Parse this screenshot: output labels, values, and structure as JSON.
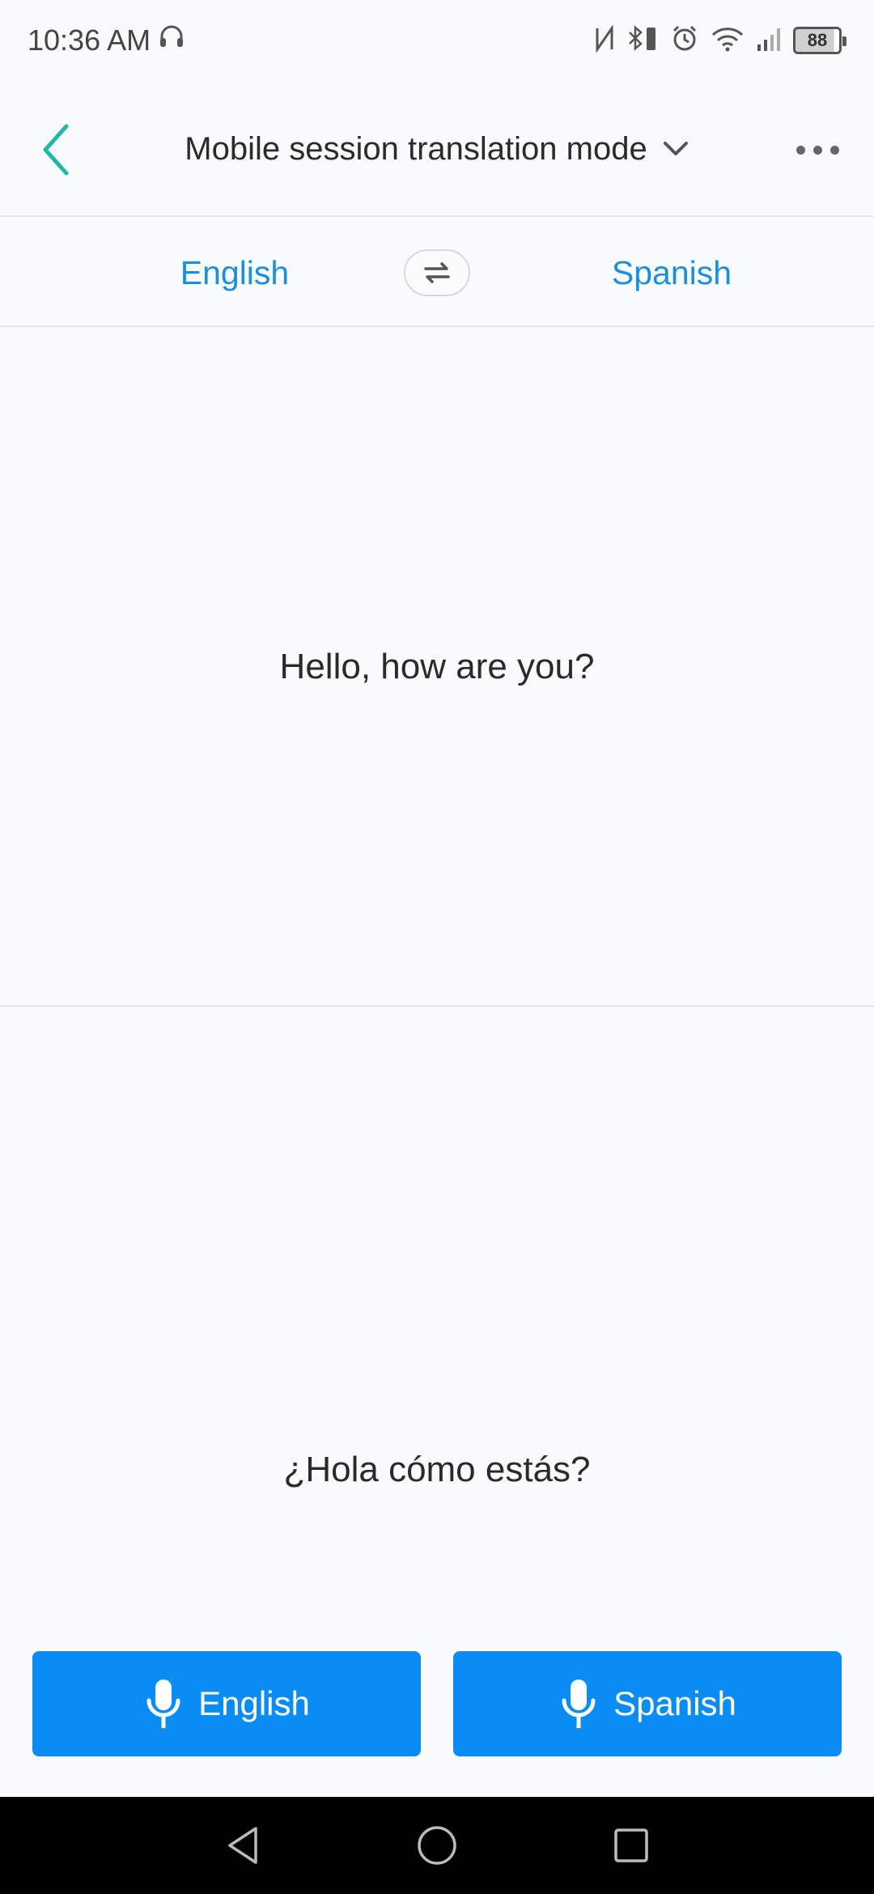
{
  "status_bar": {
    "time": "10:36 AM",
    "battery": "88",
    "icons": [
      "headset-icon",
      "nfc-icon",
      "bluetooth-icon",
      "alarm-icon",
      "wifi-icon",
      "signal-icon",
      "battery-icon"
    ]
  },
  "header": {
    "title": "Mobile session translation mode",
    "back_icon": "chevron-left-icon",
    "dropdown_icon": "chevron-down-icon",
    "more_icon": "more-horizontal-icon"
  },
  "languages": {
    "source": "English",
    "target": "Spanish",
    "swap_icon": "swap-arrows-icon"
  },
  "panels": {
    "source_text": "Hello, how are you?",
    "translated_text": "¿Hola cómo estás?"
  },
  "mic_buttons": {
    "left_label": "English",
    "right_label": "Spanish",
    "icon": "microphone-icon"
  },
  "colors": {
    "accent": "#0a8cf2",
    "link": "#1a8fe0",
    "back_arrow": "#1fb8a8",
    "background": "#f9fafc"
  }
}
